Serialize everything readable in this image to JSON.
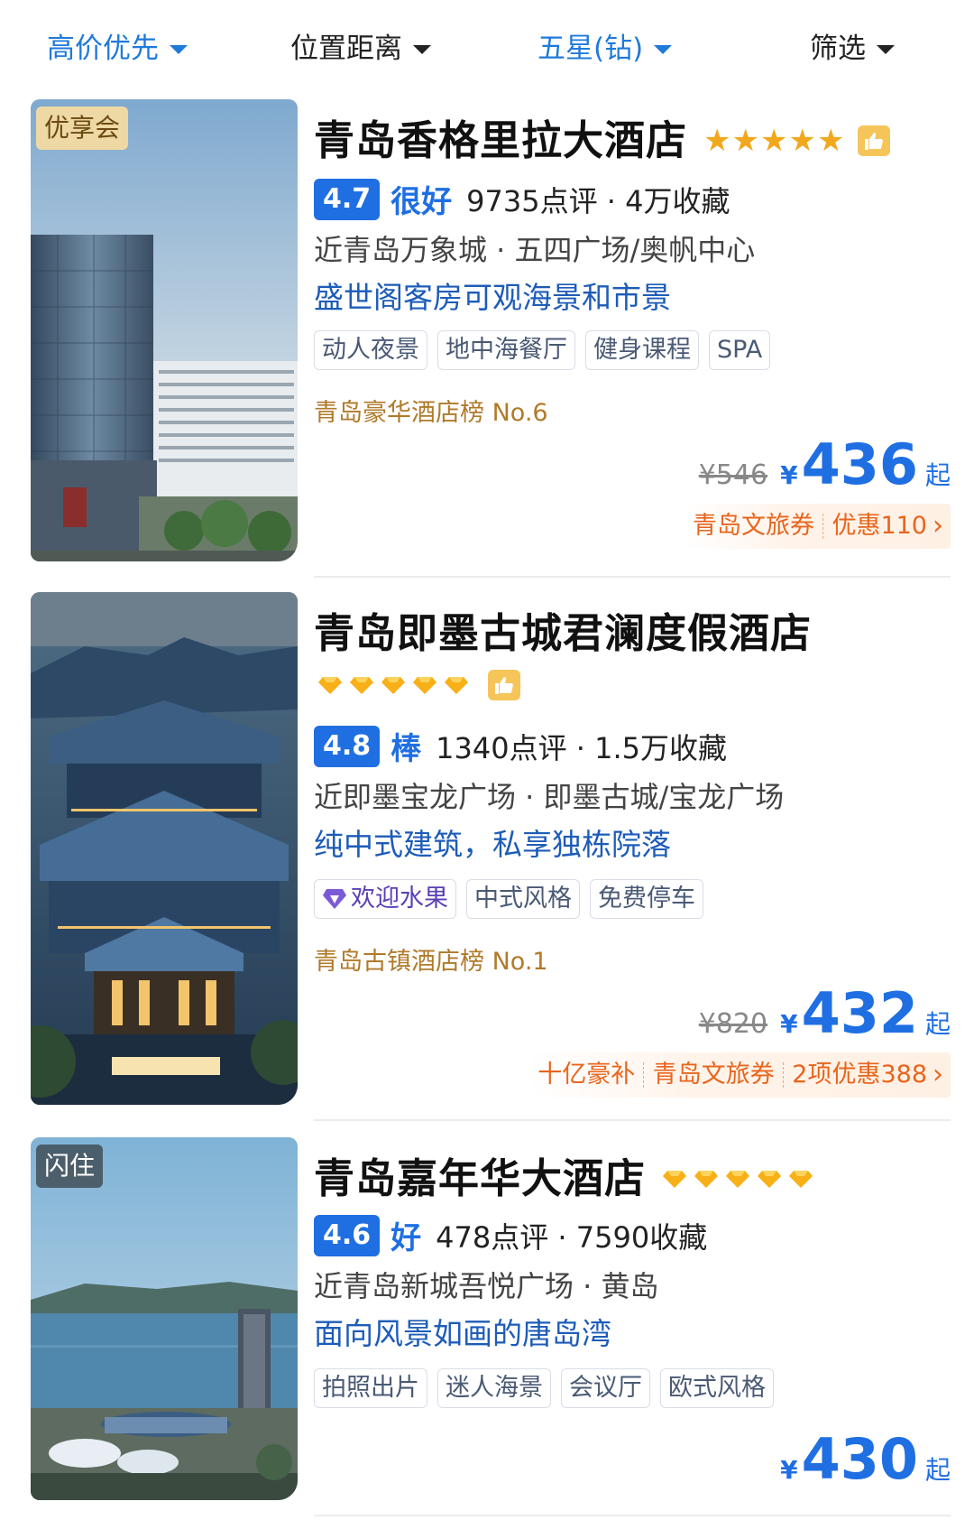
{
  "filters": [
    {
      "label": "高价优先",
      "active": true
    },
    {
      "label": "位置距离",
      "active": false
    },
    {
      "label": "五星(钻)",
      "active": true
    },
    {
      "label": "筛选",
      "active": false
    }
  ],
  "hotels": [
    {
      "badge": "优享会",
      "name": "青岛香格里拉大酒店",
      "rating_icon": "star-icon",
      "rating_count": 5,
      "score": "4.7",
      "score_word": "很好",
      "reviews": "9735点评 · 4万收藏",
      "location": "近青岛万象城 · 五四广场/奥帆中心",
      "highlight": "盛世阁客房可观海景和市景",
      "tags": [
        "动人夜景",
        "地中海餐厅",
        "健身课程",
        "SPA"
      ],
      "rank": "青岛豪华酒店榜 No.6",
      "original_price": "¥546",
      "currency": "¥",
      "price": "436",
      "price_suffix": "起",
      "promos": [
        "青岛文旅券",
        "优惠110"
      ]
    },
    {
      "badge": "",
      "name": "青岛即墨古城君澜度假酒店",
      "rating_icon": "diamond-icon",
      "rating_count": 5,
      "score": "4.8",
      "score_word": "棒",
      "reviews": "1340点评 · 1.5万收藏",
      "location": "近即墨宝龙广场 · 即墨古城/宝龙广场",
      "highlight": "纯中式建筑，私享独栋院落",
      "tags": [
        "欢迎水果",
        "中式风格",
        "免费停车"
      ],
      "rank": "青岛古镇酒店榜 No.1",
      "original_price": "¥820",
      "currency": "¥",
      "price": "432",
      "price_suffix": "起",
      "promos": [
        "十亿豪补",
        "青岛文旅券",
        "2项优惠388"
      ]
    },
    {
      "badge": "闪住",
      "name": "青岛嘉年华大酒店",
      "rating_icon": "diamond-icon",
      "rating_count": 5,
      "score": "4.6",
      "score_word": "好",
      "reviews": "478点评 · 7590收藏",
      "location": "近青岛新城吾悦广场 · 黄岛",
      "highlight": "面向风景如画的唐岛湾",
      "tags": [
        "拍照出片",
        "迷人海景",
        "会议厅",
        "欧式风格"
      ],
      "currency": "¥",
      "price": "430",
      "price_suffix": "起"
    }
  ],
  "colors": {
    "accent_blue": "#1f6fe3",
    "filter_blue": "#1f7ad9",
    "promo_orange": "#e8651c",
    "star_gold": "#f2a81d"
  }
}
